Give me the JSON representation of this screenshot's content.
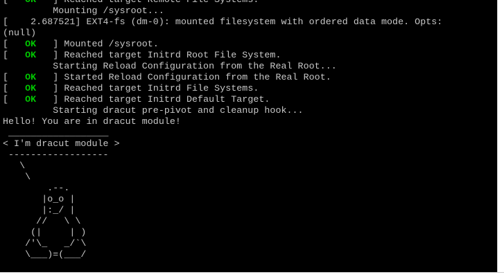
{
  "window": {
    "colors": {
      "background": "#000000",
      "text": "#c8c8c8",
      "ok": "#00c800"
    }
  },
  "console": {
    "lines": [
      {
        "type": "status",
        "status": " OK ",
        "text": "Reached target Remote File Systems."
      },
      {
        "type": "text",
        "text": "         Mounting /sysroot..."
      },
      {
        "type": "text",
        "text": "[    2.687521] EXT4-fs (dm-0): mounted filesystem with ordered data mode. Opts:"
      },
      {
        "type": "text",
        "text": "(null)"
      },
      {
        "type": "status",
        "status": " OK ",
        "text": "Mounted /sysroot."
      },
      {
        "type": "status",
        "status": " OK ",
        "text": "Reached target Initrd Root File System."
      },
      {
        "type": "text",
        "text": "         Starting Reload Configuration from the Real Root..."
      },
      {
        "type": "status",
        "status": " OK ",
        "text": "Started Reload Configuration from the Real Root."
      },
      {
        "type": "status",
        "status": " OK ",
        "text": "Reached target Initrd File Systems."
      },
      {
        "type": "status",
        "status": " OK ",
        "text": "Reached target Initrd Default Target."
      },
      {
        "type": "text",
        "text": "         Starting dracut pre-pivot and cleanup hook..."
      },
      {
        "type": "text",
        "text": "Hello! You are in dracut module!"
      },
      {
        "type": "text",
        "text": " __________________"
      },
      {
        "type": "text",
        "text": "< I'm dracut module >"
      },
      {
        "type": "text",
        "text": " ------------------"
      },
      {
        "type": "text",
        "text": "   \\"
      },
      {
        "type": "text",
        "text": "    \\"
      },
      {
        "type": "text",
        "text": "        .--."
      },
      {
        "type": "text",
        "text": "       |o_o |"
      },
      {
        "type": "text",
        "text": "       |:_/ |"
      },
      {
        "type": "text",
        "text": "      //   \\ \\"
      },
      {
        "type": "text",
        "text": "     (|     | )"
      },
      {
        "type": "text",
        "text": "    /'\\_   _/`\\"
      },
      {
        "type": "text",
        "text": "    \\___)=(___/"
      }
    ]
  }
}
